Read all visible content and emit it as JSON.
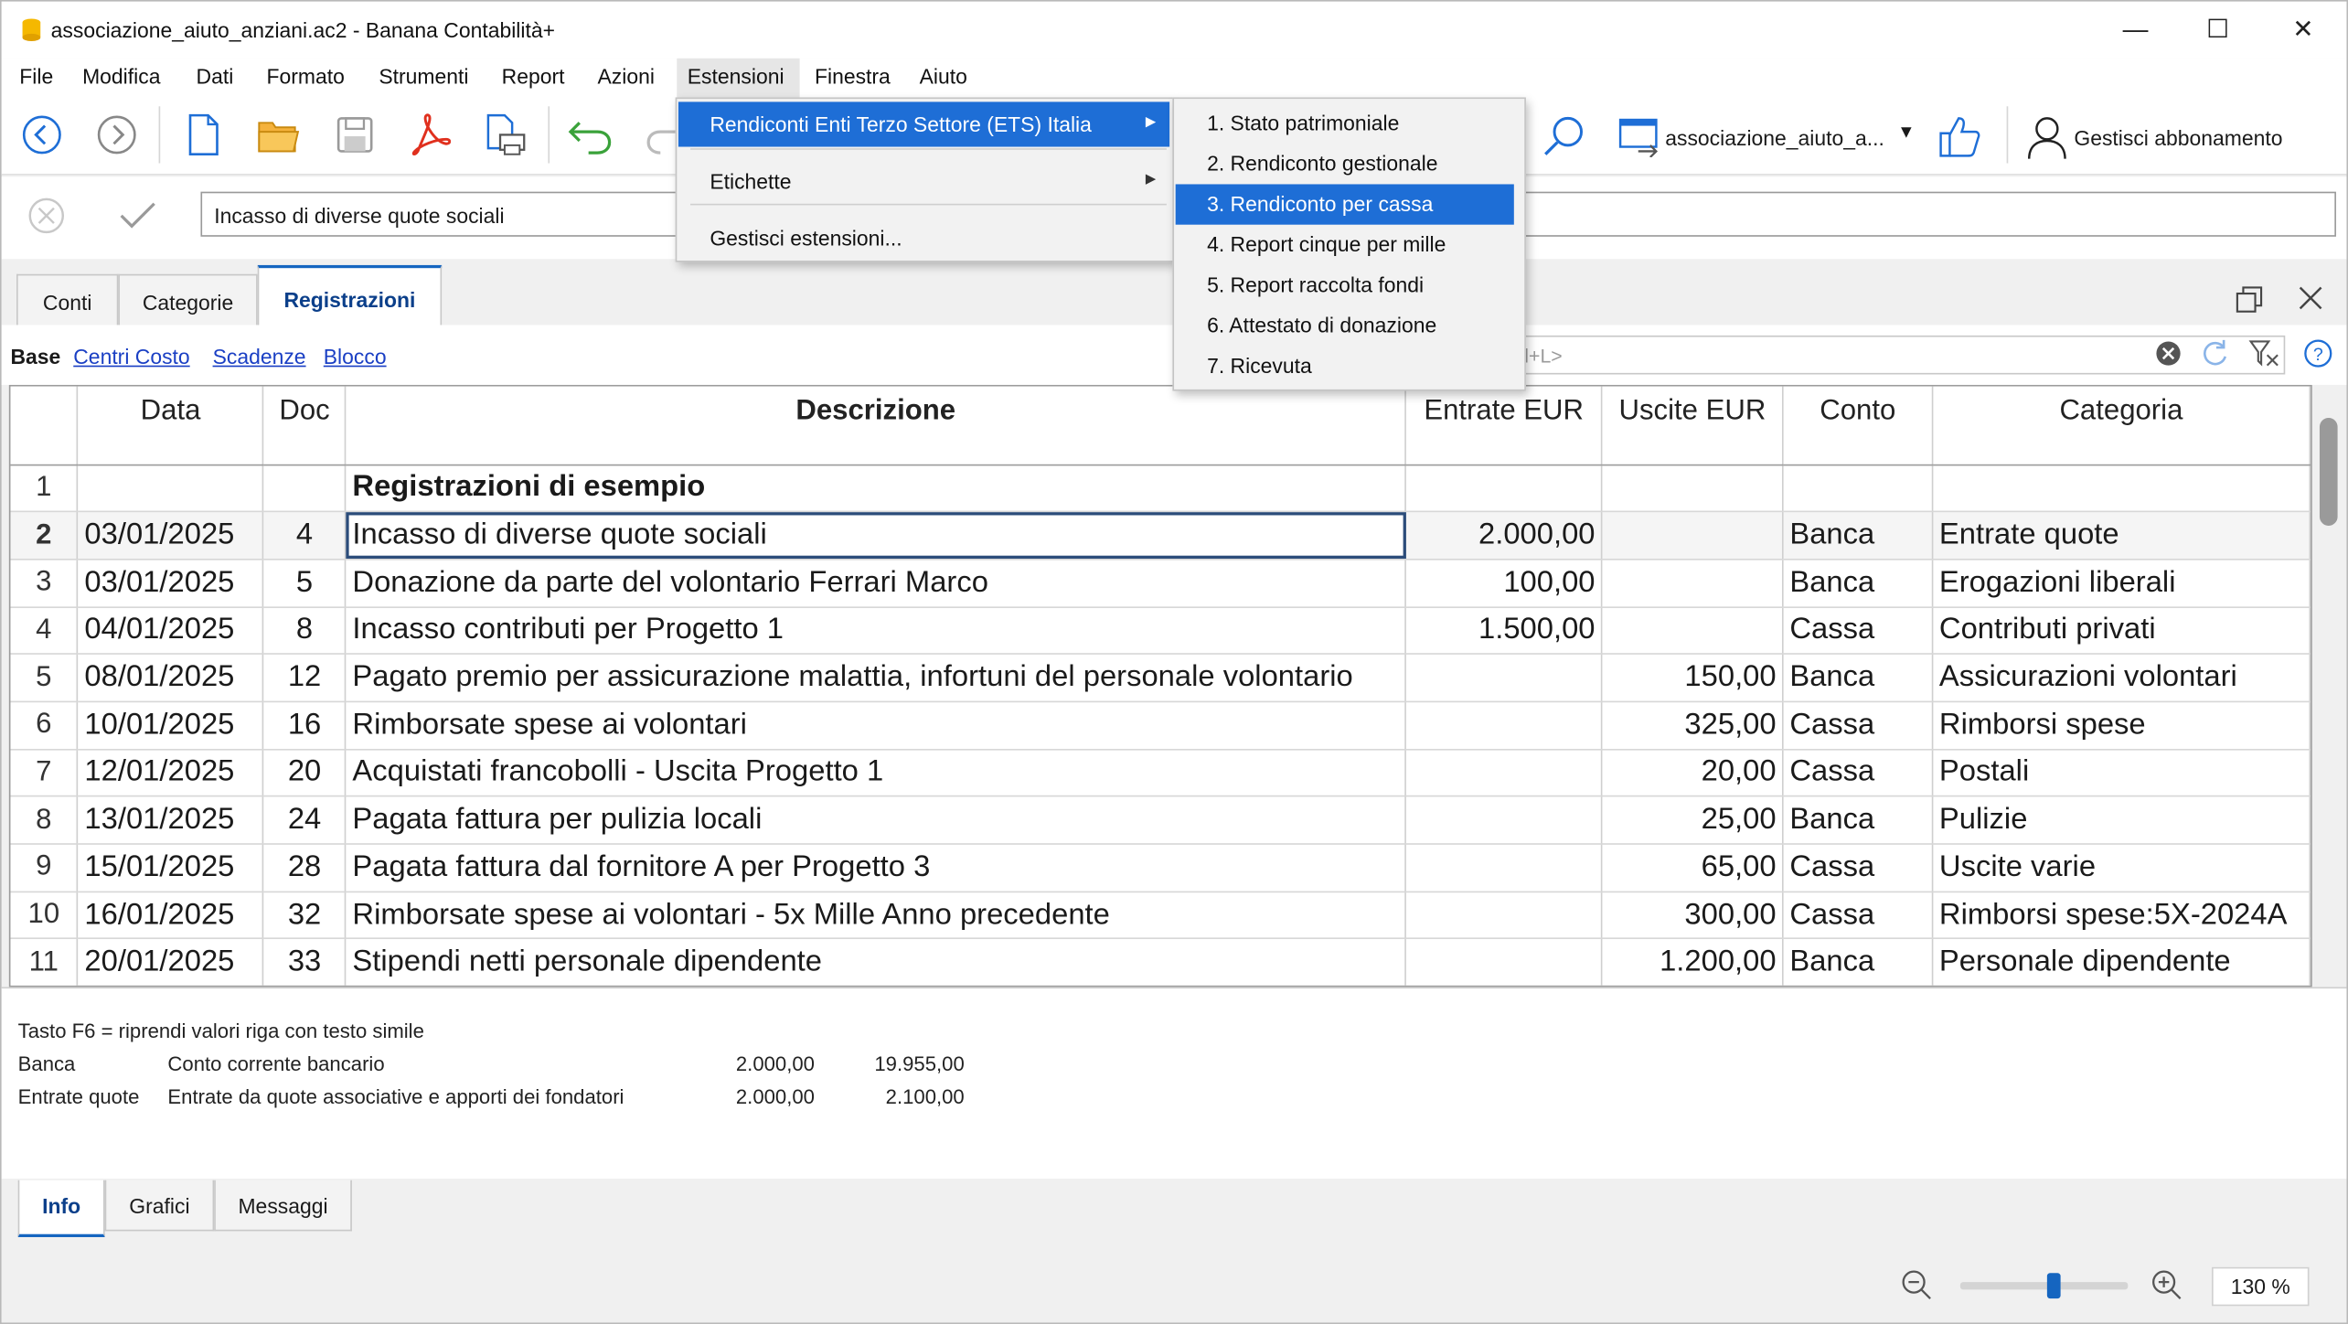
{
  "window": {
    "title": "associazione_aiuto_anziani.ac2 - Banana Contabilità+",
    "minimize": "—",
    "maximize": "☐",
    "close": "✕"
  },
  "menubar": [
    "File",
    "Modifica",
    "Dati",
    "Formato",
    "Strumenti",
    "Report",
    "Azioni",
    "Estensioni",
    "Finestra",
    "Aiuto"
  ],
  "toolbar": {
    "file_selector": "associazione_aiuto_a...",
    "manage_subscription": "Gestisci abbonamento"
  },
  "edit_field": {
    "value": "Incasso di diverse quote sociali"
  },
  "tabs": [
    "Conti",
    "Categorie",
    "Registrazioni"
  ],
  "active_tab": "Registrazioni",
  "views": {
    "base": "Base",
    "links": [
      "Centri Costo",
      "Scadenze",
      "Blocco"
    ]
  },
  "search": {
    "hint": "l+L>"
  },
  "extensions_menu": {
    "items": [
      {
        "label": "Rendiconti Enti Terzo Settore (ETS) Italia",
        "submenu": true,
        "highlighted": true
      },
      {
        "label": "Etichette",
        "submenu": true
      },
      {
        "label": "Gestisci estensioni...",
        "submenu": false
      }
    ],
    "submenu_items": [
      "1. Stato patrimoniale",
      "2. Rendiconto gestionale",
      "3. Rendiconto per cassa",
      "4. Report cinque per mille",
      "5. Report raccolta fondi",
      "6. Attestato di donazione",
      "7. Ricevuta"
    ],
    "submenu_highlighted": "3. Rendiconto per cassa"
  },
  "table": {
    "columns": [
      "Data",
      "Doc",
      "Descrizione",
      "Entrate EUR",
      "Uscite EUR",
      "Conto",
      "Categoria"
    ],
    "rows": [
      {
        "n": "1",
        "data": "",
        "doc": "",
        "desc": "Registrazioni di esempio",
        "entrate": "",
        "uscite": "",
        "conto": "",
        "categoria": ""
      },
      {
        "n": "2",
        "data": "03/01/2025",
        "doc": "4",
        "desc": "Incasso di diverse quote sociali",
        "entrate": "2.000,00",
        "uscite": "",
        "conto": "Banca",
        "categoria": "Entrate quote"
      },
      {
        "n": "3",
        "data": "03/01/2025",
        "doc": "5",
        "desc": "Donazione da parte del volontario Ferrari Marco",
        "entrate": "100,00",
        "uscite": "",
        "conto": "Banca",
        "categoria": "Erogazioni liberali"
      },
      {
        "n": "4",
        "data": "04/01/2025",
        "doc": "8",
        "desc": "Incasso contributi per Progetto 1",
        "entrate": "1.500,00",
        "uscite": "",
        "conto": "Cassa",
        "categoria": "Contributi privati"
      },
      {
        "n": "5",
        "data": "08/01/2025",
        "doc": "12",
        "desc": "Pagato premio per assicurazione malattia, infortuni del personale volontario",
        "entrate": "",
        "uscite": "150,00",
        "conto": "Banca",
        "categoria": "Assicurazioni volontari"
      },
      {
        "n": "6",
        "data": "10/01/2025",
        "doc": "16",
        "desc": "Rimborsate spese ai volontari",
        "entrate": "",
        "uscite": "325,00",
        "conto": "Cassa",
        "categoria": "Rimborsi spese"
      },
      {
        "n": "7",
        "data": "12/01/2025",
        "doc": "20",
        "desc": "Acquistati francobolli - Uscita Progetto 1",
        "entrate": "",
        "uscite": "20,00",
        "conto": "Cassa",
        "categoria": "Postali"
      },
      {
        "n": "8",
        "data": "13/01/2025",
        "doc": "24",
        "desc": "Pagata fattura per pulizia locali",
        "entrate": "",
        "uscite": "25,00",
        "conto": "Banca",
        "categoria": "Pulizie"
      },
      {
        "n": "9",
        "data": "15/01/2025",
        "doc": "28",
        "desc": "Pagata fattura dal fornitore A per Progetto 3",
        "entrate": "",
        "uscite": "65,00",
        "conto": "Cassa",
        "categoria": "Uscite varie"
      },
      {
        "n": "10",
        "data": "16/01/2025",
        "doc": "32",
        "desc": "Rimborsate spese ai volontari - 5x Mille Anno precedente",
        "entrate": "",
        "uscite": "300,00",
        "conto": "Cassa",
        "categoria": "Rimborsi spese:5X-2024A"
      },
      {
        "n": "11",
        "data": "20/01/2025",
        "doc": "33",
        "desc": "Stipendi netti personale dipendente",
        "entrate": "",
        "uscite": "1.200,00",
        "conto": "Banca",
        "categoria": "Personale dipendente"
      }
    ],
    "current_row": "2"
  },
  "info_panel": {
    "hint": "Tasto F6 = riprendi valori riga con testo simile",
    "rows": [
      {
        "account": "Banca",
        "description": "Conto corrente bancario",
        "amount": "2.000,00",
        "balance": "19.955,00"
      },
      {
        "account": "Entrate quote",
        "description": "Entrate da quote associative e apporti dei fondatori",
        "amount": "2.000,00",
        "balance": "2.100,00"
      }
    ]
  },
  "bottom_tabs": [
    "Info",
    "Grafici",
    "Messaggi"
  ],
  "status": {
    "zoom": "130 %",
    "zoom_level": 0.55
  },
  "colors": {
    "accent": "#1e6ed6",
    "active_tab_text": "#0b3f8a",
    "link": "#1a3fc4"
  }
}
